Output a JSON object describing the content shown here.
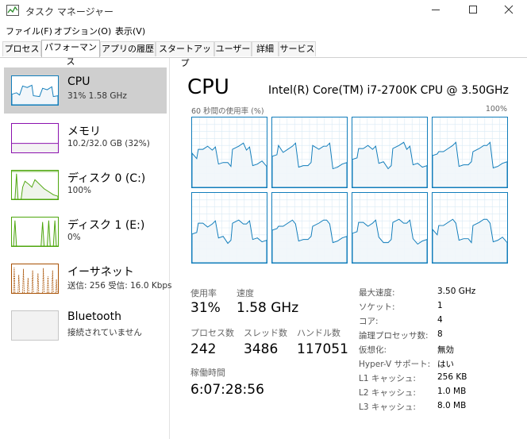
{
  "window": {
    "title": "タスク マネージャー",
    "controls": [
      "minimize-icon",
      "maximize-icon",
      "close-icon"
    ]
  },
  "menu": [
    "ファイル(F)",
    "オプション(O)",
    "表示(V)"
  ],
  "tabs": [
    {
      "label": "プロセス",
      "active": false
    },
    {
      "label": "パフォーマンス",
      "active": true
    },
    {
      "label": "アプリの履歴",
      "active": false
    },
    {
      "label": "スタートアップ",
      "active": false
    },
    {
      "label": "ユーザー",
      "active": false
    },
    {
      "label": "詳細",
      "active": false
    },
    {
      "label": "サービス",
      "active": false
    }
  ],
  "sidebar": {
    "items": [
      {
        "title": "CPU",
        "sub": "31%  1.58 GHz",
        "color": "#117dbb",
        "selected": true
      },
      {
        "title": "メモリ",
        "sub": "10.2/32.0 GB (32%)",
        "color": "#8b12ae",
        "selected": false
      },
      {
        "title": "ディスク 0 (C:)",
        "sub": "100%",
        "color": "#4da60c",
        "selected": false
      },
      {
        "title": "ディスク 1 (E:)",
        "sub": "0%",
        "color": "#4da60c",
        "selected": false
      },
      {
        "title": "イーサネット",
        "sub": "送信: 256  受信: 16.0 Kbps",
        "color": "#a74f01",
        "selected": false
      },
      {
        "title": "Bluetooth",
        "sub": "接続されていません",
        "color": "#999999",
        "selected": false
      }
    ]
  },
  "main": {
    "title": "CPU",
    "model": "Intel(R) Core(TM) i7-2700K CPU @ 3.50GHz",
    "graph_caption_left": "60 秒間の使用率 (%)",
    "graph_caption_right": "100%",
    "stats": {
      "usage_label": "使用率",
      "usage": "31%",
      "speed_label": "速度",
      "speed": "1.58 GHz",
      "processes_label": "プロセス数",
      "processes": "242",
      "threads_label": "スレッド数",
      "threads": "3486",
      "handles_label": "ハンドル数",
      "handles": "117051",
      "uptime_label": "稼働時間",
      "uptime": "6:07:28:56"
    },
    "specs": [
      {
        "label": "最大速度:",
        "value": "3.50 GHz"
      },
      {
        "label": "ソケット:",
        "value": "1"
      },
      {
        "label": "コア:",
        "value": "4"
      },
      {
        "label": "論理プロセッサ数:",
        "value": "8"
      },
      {
        "label": "仮想化:",
        "value": "無効"
      },
      {
        "label": "Hyper-V サポート:",
        "value": "はい"
      },
      {
        "label": "L1 キャッシュ:",
        "value": "256 KB"
      },
      {
        "label": "L2 キャッシュ:",
        "value": "1.0 MB"
      },
      {
        "label": "L3 キャッシュ:",
        "value": "8.0 MB"
      }
    ]
  },
  "colors": {
    "cpu": "#117dbb",
    "cpu_fill": "#f1f6fa",
    "grid": "#d9eaf4",
    "selected": "#cfcfcf"
  }
}
